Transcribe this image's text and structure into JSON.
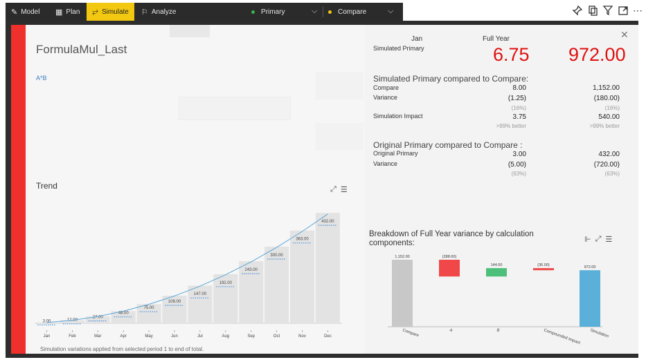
{
  "toolbar": {
    "model": "Model",
    "plan": "Plan",
    "simulate": "Simulate",
    "analyze": "Analyze",
    "primary": "Primary",
    "compare": "Compare",
    "primary_color": "#3cb54a",
    "compare_color": "#f2c811",
    "active_color": "#f2c811"
  },
  "left": {
    "title": "FormulaMul_Last",
    "formula": "A*B",
    "trend_title": "Trend",
    "footer": "Simulation variations applied from selected period 1 to end of total."
  },
  "summary": {
    "col_period": "Jan",
    "col_year": "Full Year",
    "sim_primary_label": "Simulated Primary",
    "sim_primary_period": "6.75",
    "sim_primary_year": "972.00",
    "section1_title": "Simulated Primary compared to Compare:",
    "compare_label": "Compare",
    "compare_period": "8.00",
    "compare_year": "1,152.00",
    "variance_label": "Variance",
    "variance_period": "(1.25)",
    "variance_year": "(180.00)",
    "variance_pct_period": "(16%)",
    "variance_pct_year": "(16%)",
    "impact_label": "Simulation Impact",
    "impact_period": "3.75",
    "impact_year": "540.00",
    "impact_note_period": ">99% better",
    "impact_note_year": ">99% better",
    "section2_title": "Original Primary compared to Compare :",
    "orig_label": "Original Primary",
    "orig_period": "3.00",
    "orig_year": "432.00",
    "orig_variance_label": "Variance",
    "orig_variance_period": "(5.00)",
    "orig_variance_year": "(720.00)",
    "orig_pct_period": "(63%)",
    "orig_pct_year": "(63%)",
    "big_color": "#e01010"
  },
  "breakdown": {
    "title": "Breakdown of Full Year variance by calculation components:"
  },
  "chart_data": [
    {
      "type": "bar",
      "name": "Trend",
      "categories": [
        "Jan",
        "Feb",
        "Mar",
        "Apr",
        "May",
        "Jun",
        "Jul",
        "Aug",
        "Sep",
        "Oct",
        "Nov",
        "Dec"
      ],
      "values": [
        3,
        12,
        27,
        48,
        75,
        108,
        147,
        192,
        243,
        300,
        363,
        432
      ],
      "labels": [
        "3.00",
        "12.00",
        "27.00",
        "48.00",
        "75.00",
        "108.00",
        "147.00",
        "192.00",
        "243.00",
        "300.00",
        "363.00",
        "432.00"
      ],
      "line_values": [
        6.75,
        27,
        60.75,
        108,
        168.75,
        243,
        330.75,
        432,
        546.75,
        675,
        816.75,
        972
      ],
      "ylim": [
        0,
        1000
      ],
      "bar_color": "#e3e3e3",
      "line_color": "#5aa6d6",
      "marker_color": "#4a90d9"
    },
    {
      "type": "bar",
      "name": "Breakdown",
      "categories": [
        "Compare",
        "A",
        "B",
        "Compounded Impact",
        "Simulation"
      ],
      "values": [
        1152,
        -288,
        144,
        -36,
        972
      ],
      "labels": [
        "1,152.00",
        "(288.00)",
        "144.00",
        "(36.00)",
        "972.00"
      ],
      "ylim": [
        0,
        1200
      ],
      "colors": [
        "#c8c8c8",
        "#f04848",
        "#4cc07a",
        "#f04848",
        "#5ab0d8"
      ]
    }
  ]
}
